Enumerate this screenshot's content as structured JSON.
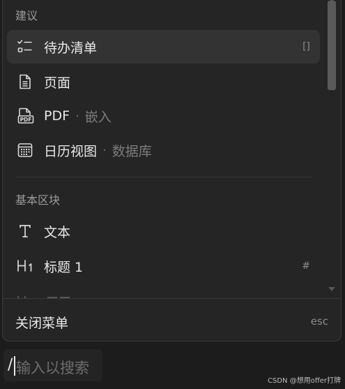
{
  "menu": {
    "sections": [
      {
        "title": "建议",
        "items": [
          {
            "label": "待办清单",
            "desc": "",
            "shortcut": "[]",
            "icon": "checklist-icon",
            "selected": true
          },
          {
            "label": "页面",
            "desc": "",
            "shortcut": "",
            "icon": "page-icon"
          },
          {
            "label": "PDF",
            "desc": "嵌入",
            "shortcut": "",
            "icon": "pdf-icon"
          },
          {
            "label": "日历视图",
            "desc": "数据库",
            "shortcut": "",
            "icon": "calendar-icon"
          }
        ]
      },
      {
        "title": "基本区块",
        "items": [
          {
            "label": "文本",
            "desc": "",
            "shortcut": "",
            "icon": "text-icon"
          },
          {
            "label": "标题 1",
            "desc": "",
            "shortcut": "#",
            "icon": "heading1-icon"
          }
        ]
      }
    ],
    "separator": "·",
    "footer": {
      "close_label": "关闭菜单",
      "esc_label": "esc"
    }
  },
  "search": {
    "value": "/",
    "placeholder": "输入以搜索"
  },
  "watermark": "CSDN @想用offer打牌",
  "colors": {
    "background": "#1c1c1c",
    "menu_bg": "#252525",
    "selected_bg": "#333333",
    "text": "#e8e8e8",
    "muted": "#9b9b9b"
  }
}
